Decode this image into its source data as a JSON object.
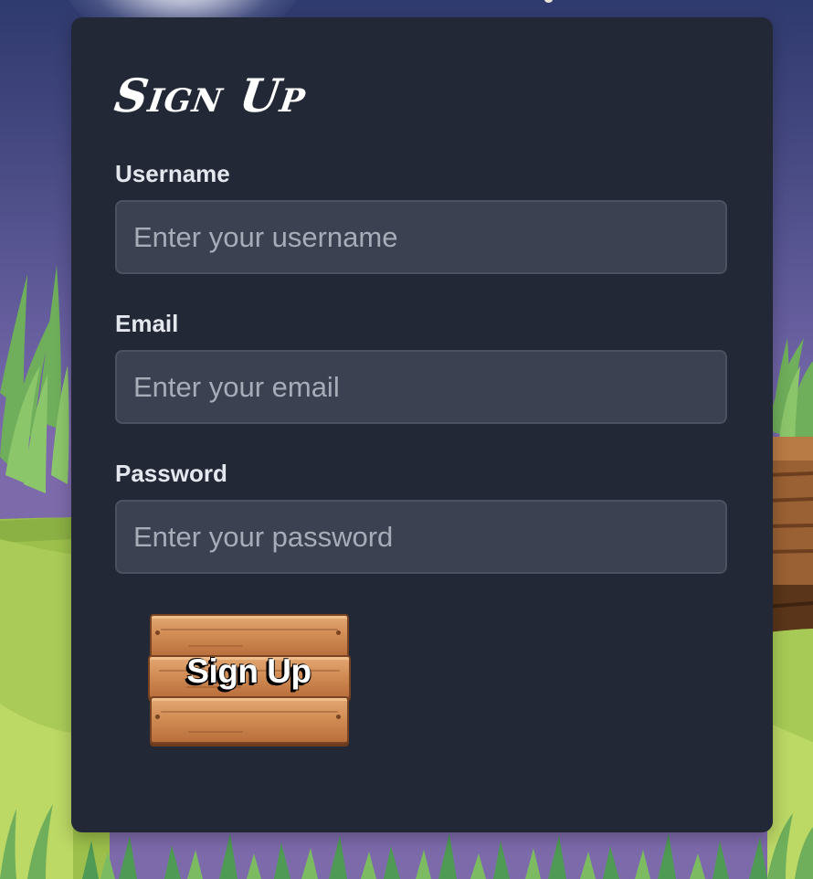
{
  "form": {
    "title": "Sign Up",
    "fields": [
      {
        "label": "Username",
        "placeholder": "Enter your username",
        "value": ""
      },
      {
        "label": "Email",
        "placeholder": "Enter your email",
        "value": ""
      },
      {
        "label": "Password",
        "placeholder": "Enter your password",
        "value": ""
      }
    ],
    "submit_label": "Sign Up"
  },
  "colors": {
    "card_bg": "#222835",
    "input_bg": "#3b4150",
    "sky_top": "#2f3a6e",
    "sky_bottom": "#7d6aab",
    "grass": "#b5d35f",
    "wood": "#d28d55"
  }
}
